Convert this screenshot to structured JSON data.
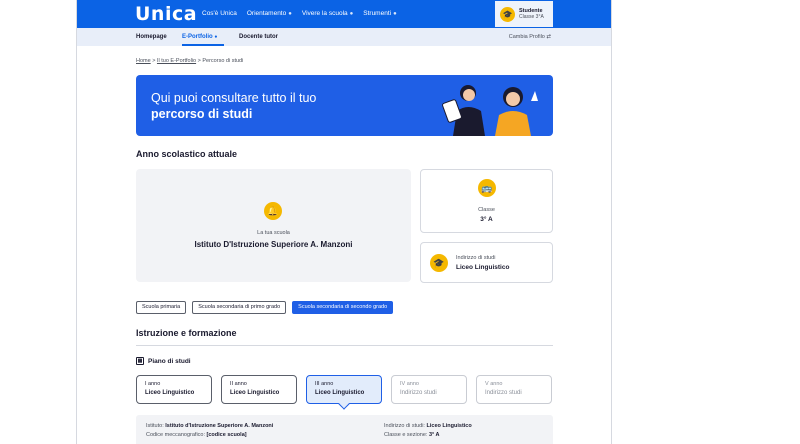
{
  "header": {
    "logo": "Unica",
    "nav": [
      {
        "label": "Cos'è Unica",
        "dot": ""
      },
      {
        "label": "Orientamento",
        "dot": "●"
      },
      {
        "label": "Vivere la scuola",
        "dot": "●"
      },
      {
        "label": "Strumenti",
        "dot": "●"
      }
    ],
    "profile": {
      "role": "Studente",
      "class": "Classe 3°A"
    }
  },
  "subnav": {
    "homepage": "Homepage",
    "eportfolio": "E-Portfolio",
    "eportfolio_dot": "●",
    "docente": "Docente tutor",
    "change_profile": "Cambia Profilo"
  },
  "breadcrumb": {
    "home": "Home",
    "sep1": " > ",
    "eportfolio": "Il tuo E-Portfolio",
    "sep2": " > ",
    "current": "Percorso di studi"
  },
  "hero": {
    "line1": "Qui puoi consultare tutto il tuo",
    "line2": "percorso di studi"
  },
  "current_year": {
    "title": "Anno scolastico attuale",
    "school_label": "La tua scuola",
    "school_value": "Istituto D'Istruzione Superiore A. Manzoni",
    "class_label": "Classe",
    "class_value": "3° A",
    "track_label": "Indirizzo di studi",
    "track_value": "Liceo Linguistico"
  },
  "school_tabs": [
    "Scuola primaria",
    "Scuola secondaria di primo grado",
    "Scuola secondaria di secondo grado"
  ],
  "education": {
    "title": "Istruzione e formazione",
    "plan_title": "Piano di studi",
    "years": [
      {
        "label": "I anno",
        "value": "Liceo Linguistico"
      },
      {
        "label": "II anno",
        "value": "Liceo Linguistico"
      },
      {
        "label": "III anno",
        "value": "Liceo Linguistico"
      },
      {
        "label": "IV anno",
        "value": "Indirizzo studi"
      },
      {
        "label": "V anno",
        "value": "Indirizzo studi"
      }
    ]
  },
  "details": {
    "institute_label": "Istituto:",
    "institute_value": "Istituto d'Istruzione Superiore A. Manzoni",
    "code_label": "Codice meccanografico:",
    "code_value": "[codice scuola]",
    "track_label": "Indirizzo di studi:",
    "track_value": "Liceo Linguistico",
    "class_label": "Classe e sezione:",
    "class_value": "3° A"
  },
  "colors": {
    "primary": "#0b63e5",
    "hero": "#1f5fe6",
    "accent": "#f5b800",
    "subnav": "#e8eef9"
  }
}
